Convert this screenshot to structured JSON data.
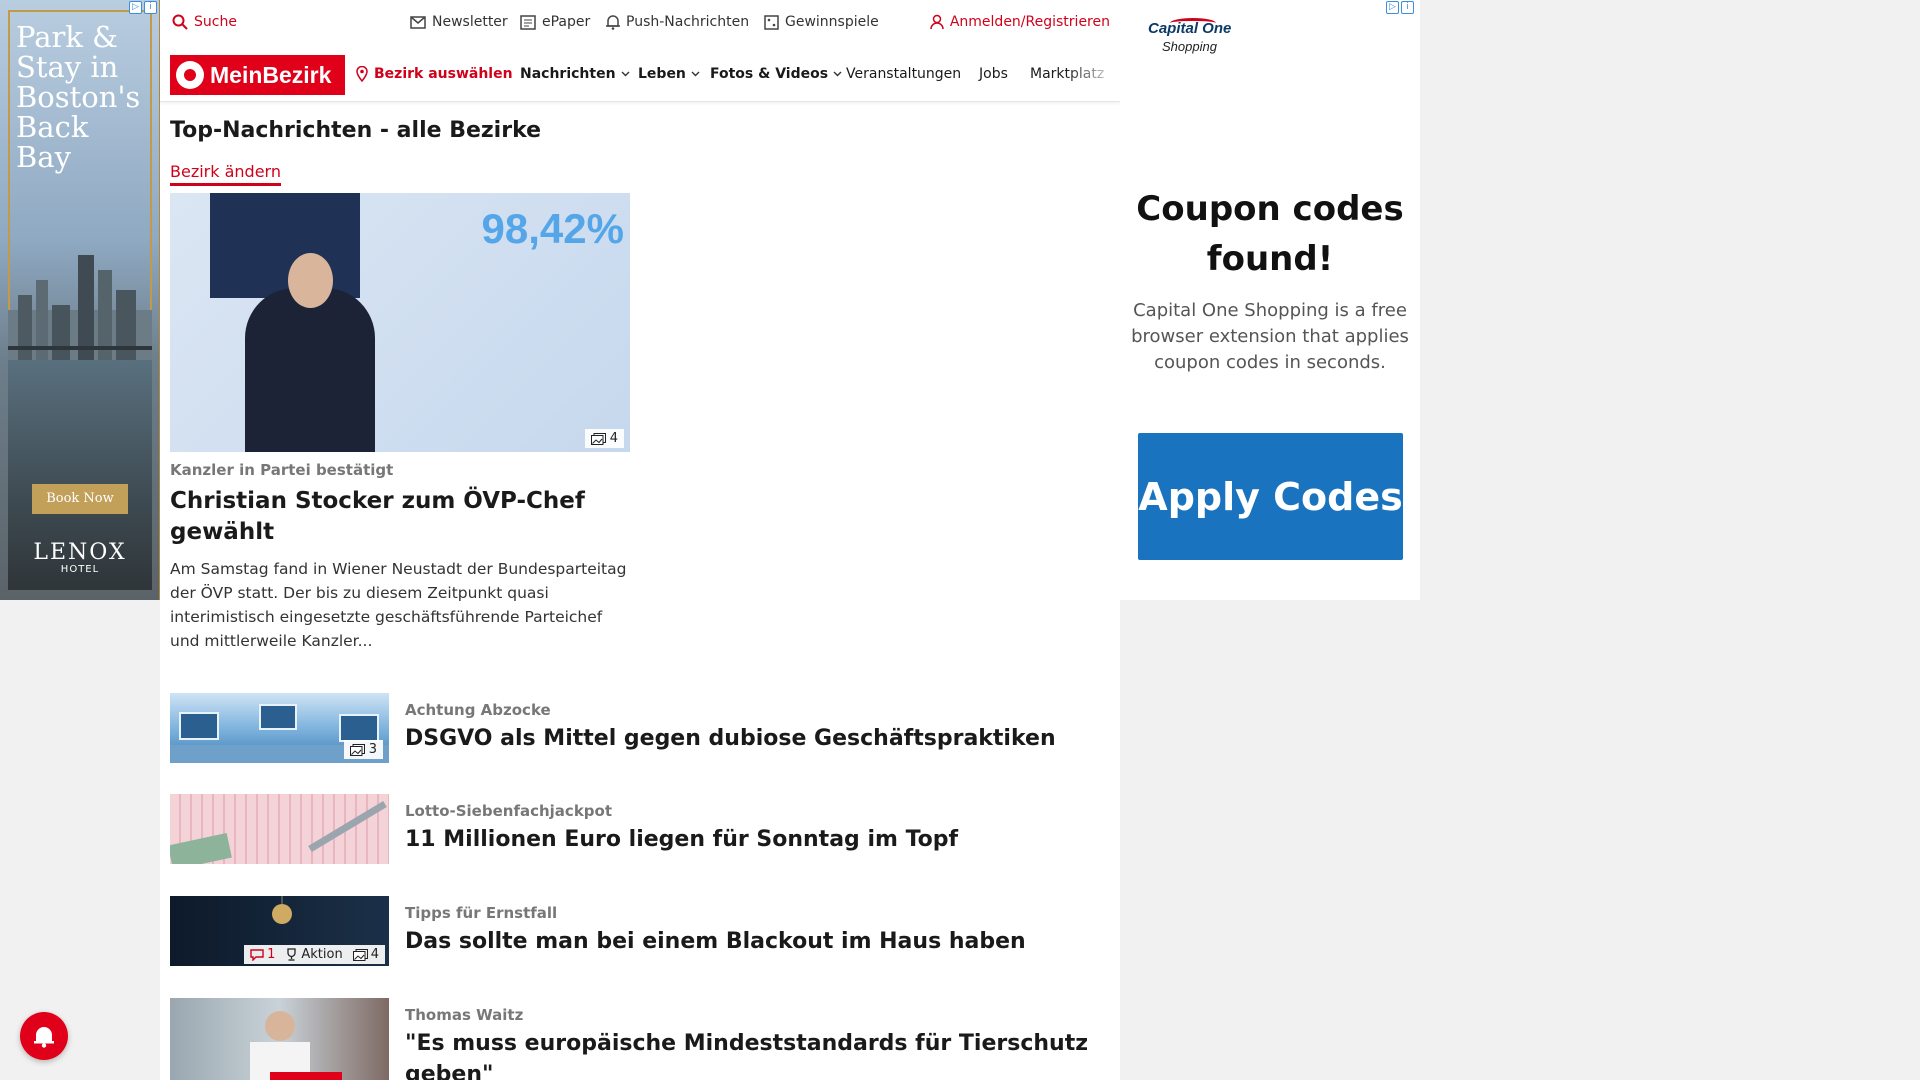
{
  "ad_left": {
    "headline": "Park & Stay in Boston's Back Bay",
    "cta": "Book Now",
    "brand": "LENOX",
    "brand_sub": "HOTEL"
  },
  "topbar": {
    "search": "Suche",
    "newsletter": "Newsletter",
    "epaper": "ePaper",
    "push": "Push-Nachrichten",
    "gewinnspiele": "Gewinnspiele",
    "login": "Anmelden/Registrieren"
  },
  "nav": {
    "logo": "MeinBezirk",
    "location": "Bezirk auswählen",
    "items": [
      "Nachrichten",
      "Leben",
      "Fotos & Videos",
      "Veranstaltungen",
      "Jobs",
      "Marktplatz"
    ]
  },
  "page": {
    "title": "Top-Nachrichten - alle Bezirke",
    "change_link": "Bezirk ändern"
  },
  "lead": {
    "image_text": "98,42%",
    "image_count": "4",
    "kicker": "Kanzler in Partei bestätigt",
    "title": "Christian Stocker zum ÖVP-Chef gewählt",
    "teaser": "Am Samstag fand in Wiener Neustadt der Bundesparteitag der ÖVP statt. Der bis zu diesem Zeitpunkt quasi interimistisch eingesetzte geschäftsführende Parteichef und mittlerweile Kanzler..."
  },
  "articles": [
    {
      "kicker": "Achtung Abzocke",
      "title": "DSGVO als Mittel gegen dubiose Geschäftspraktiken",
      "image_count": "3"
    },
    {
      "kicker": "Lotto-Siebenfachjackpot",
      "title": "11 Millionen Euro liegen für Sonntag im Topf"
    },
    {
      "kicker": "Tipps für Ernstfall",
      "title": "Das sollte man bei einem Blackout im Haus haben",
      "comments": "1",
      "aktion": "Aktion",
      "image_count": "4"
    },
    {
      "kicker": "Thomas Waitz",
      "title": "\"Es muss europäische Mindeststandards für Tierschutz geben\""
    }
  ],
  "ad_right": {
    "brand": "Capital One",
    "brand_sub": "Shopping",
    "headline": "Coupon codes found!",
    "body": "Capital One Shopping is a free browser extension that applies coupon codes in seconds.",
    "cta": "Apply Codes"
  },
  "colors": {
    "brand_red": "#e10019",
    "link_red": "#d0021b",
    "cta_blue": "#1a73be"
  }
}
